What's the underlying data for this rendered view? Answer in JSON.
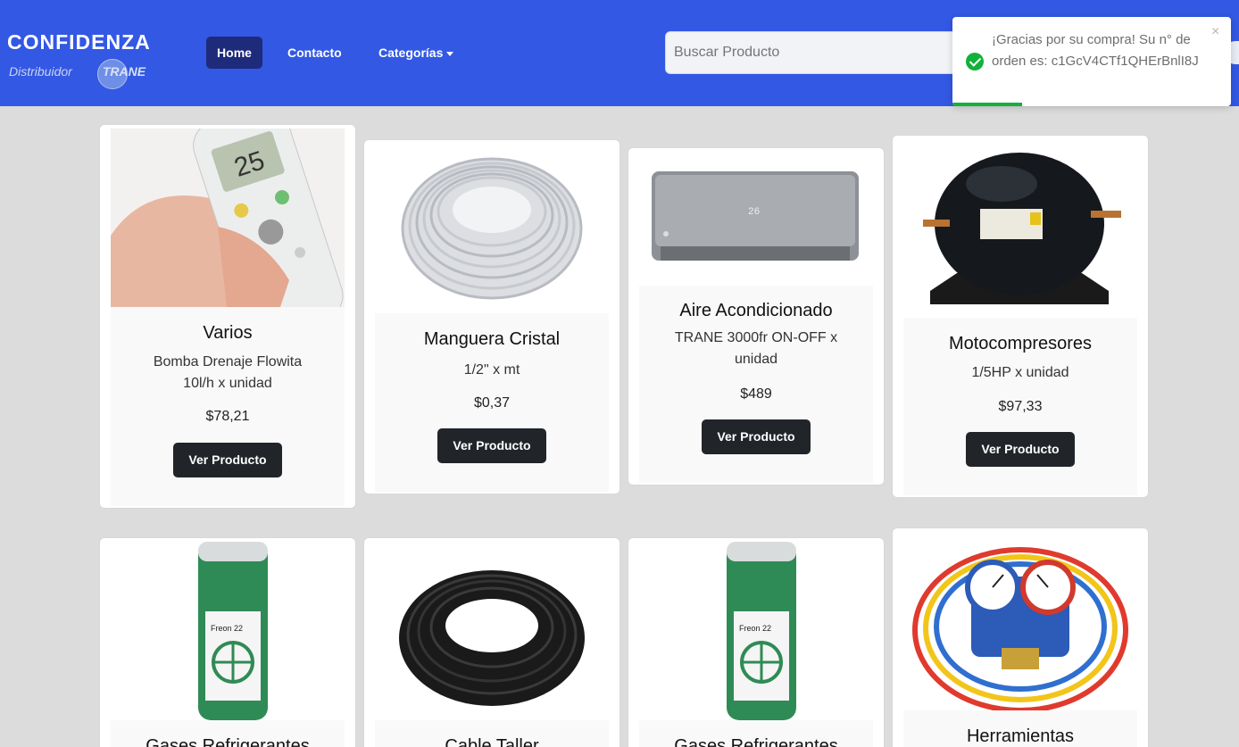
{
  "navbar": {
    "brand_name": "CONFIDENZA",
    "brand_sub": "Distribuidor",
    "brand_partner": "TRANE",
    "links": [
      {
        "label": "Home"
      },
      {
        "label": "Contacto"
      },
      {
        "label": "Categorías"
      }
    ],
    "search_placeholder": "Buscar Producto",
    "accent": "#3358e3"
  },
  "toast": {
    "message": "¡Gracias por su compra! Su n° de orden es: c1GcV4CTf1QHErBnlI8J",
    "close": "×",
    "progress": 0.25,
    "color": "#13b03b"
  },
  "products": [
    {
      "title": "Varios",
      "desc": "Bomba Drenaje Flowita 10l/h x unidad",
      "price": "$78,21",
      "button": "Ver Producto"
    },
    {
      "title": "Manguera Cristal",
      "desc": "1/2\" x mt",
      "price": "$0,37",
      "button": "Ver Producto"
    },
    {
      "title": "Aire Acondicionado",
      "desc": "TRANE 3000fr ON-OFF x unidad",
      "price": "$489",
      "button": "Ver Producto"
    },
    {
      "title": "Motocompresores",
      "desc": "1/5HP x unidad",
      "price": "$97,33",
      "button": "Ver Producto"
    },
    {
      "title": "Gases Refrigerantes"
    },
    {
      "title": "Cable Taller"
    },
    {
      "title": "Gases Refrigerantes"
    },
    {
      "title": "Herramientas"
    }
  ]
}
